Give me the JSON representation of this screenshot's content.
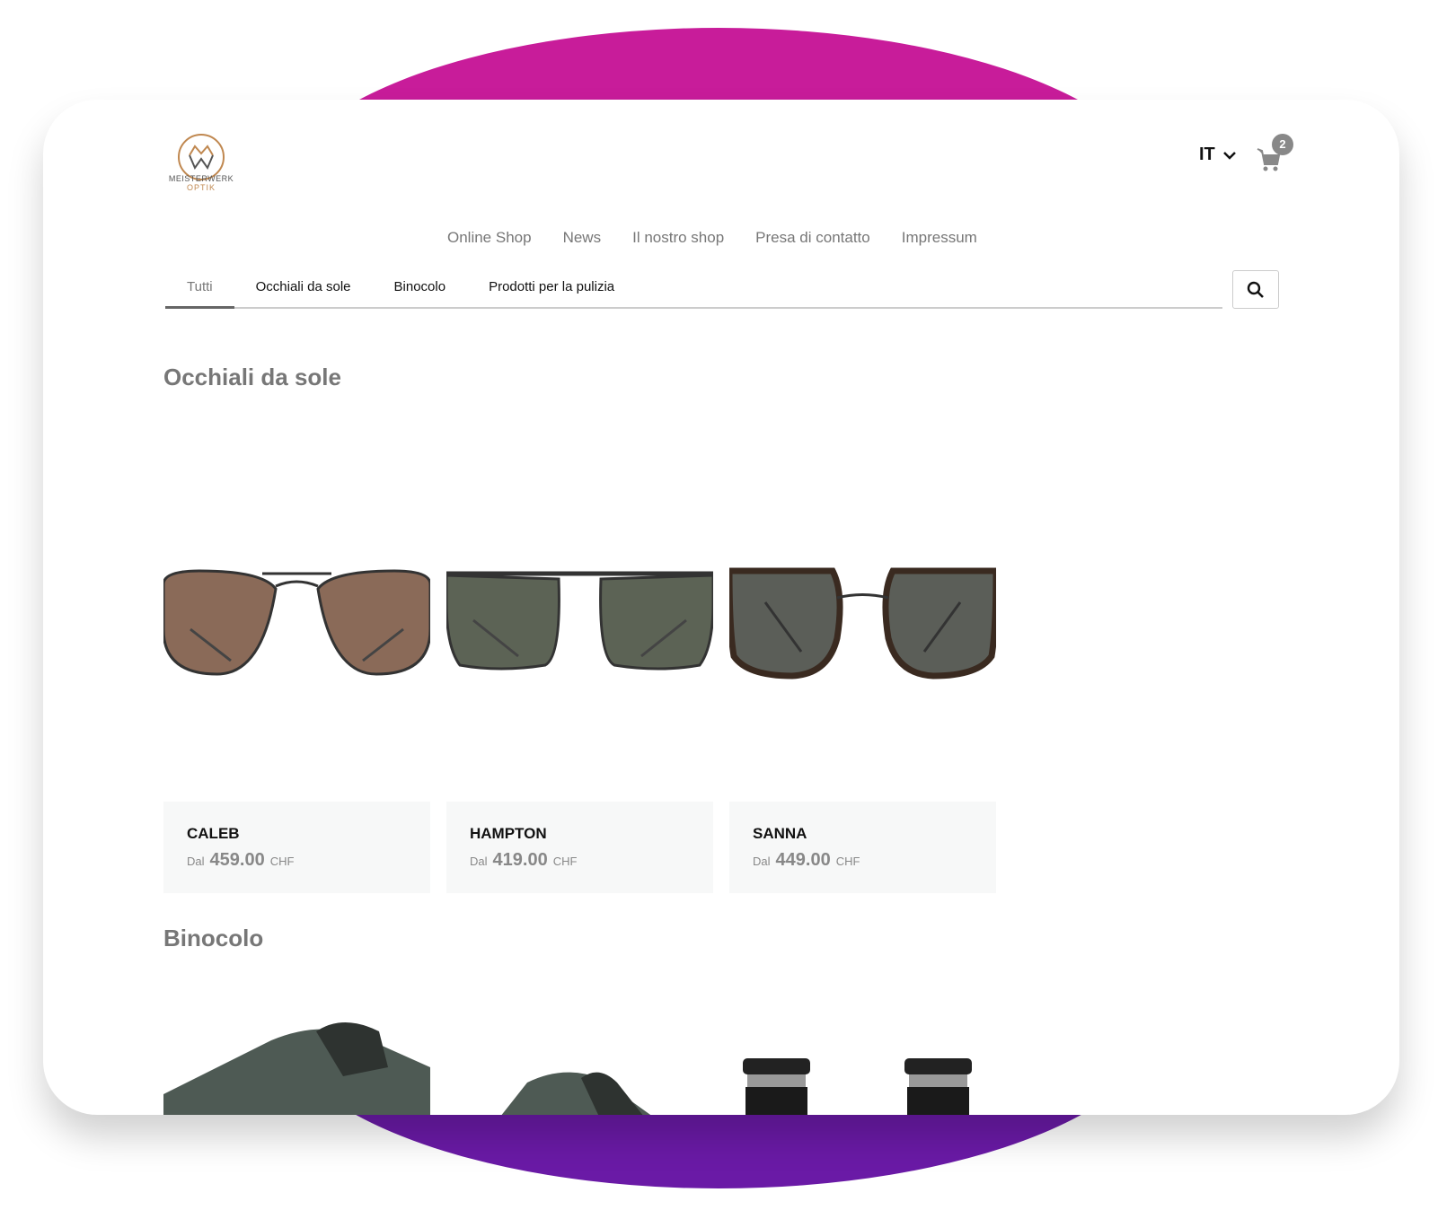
{
  "logo": {
    "line1": "MEISTERWERK",
    "line2": "OPTIK"
  },
  "header": {
    "language": "IT",
    "cart_count": "2"
  },
  "nav": [
    "Online Shop",
    "News",
    "Il nostro shop",
    "Presa di contatto",
    "Impressum"
  ],
  "tabs": [
    "Tutti",
    "Occhiali da sole",
    "Binocolo",
    "Prodotti per la pulizia"
  ],
  "sections": {
    "sunglasses": "Occhiali da sole",
    "binoculars": "Binocolo"
  },
  "products": [
    {
      "name": "CALEB",
      "from": "Dal",
      "price": "459.00",
      "currency": "CHF",
      "lens": "#8a6a58"
    },
    {
      "name": "HAMPTON",
      "from": "Dal",
      "price": "419.00",
      "currency": "CHF",
      "lens": "#5c6355"
    },
    {
      "name": "SANNA",
      "from": "Dal",
      "price": "449.00",
      "currency": "CHF",
      "lens": "#5b5e58"
    }
  ],
  "colors": {
    "top_arc": "#c81c9a",
    "bottom_arc": "#6a1aa6"
  }
}
